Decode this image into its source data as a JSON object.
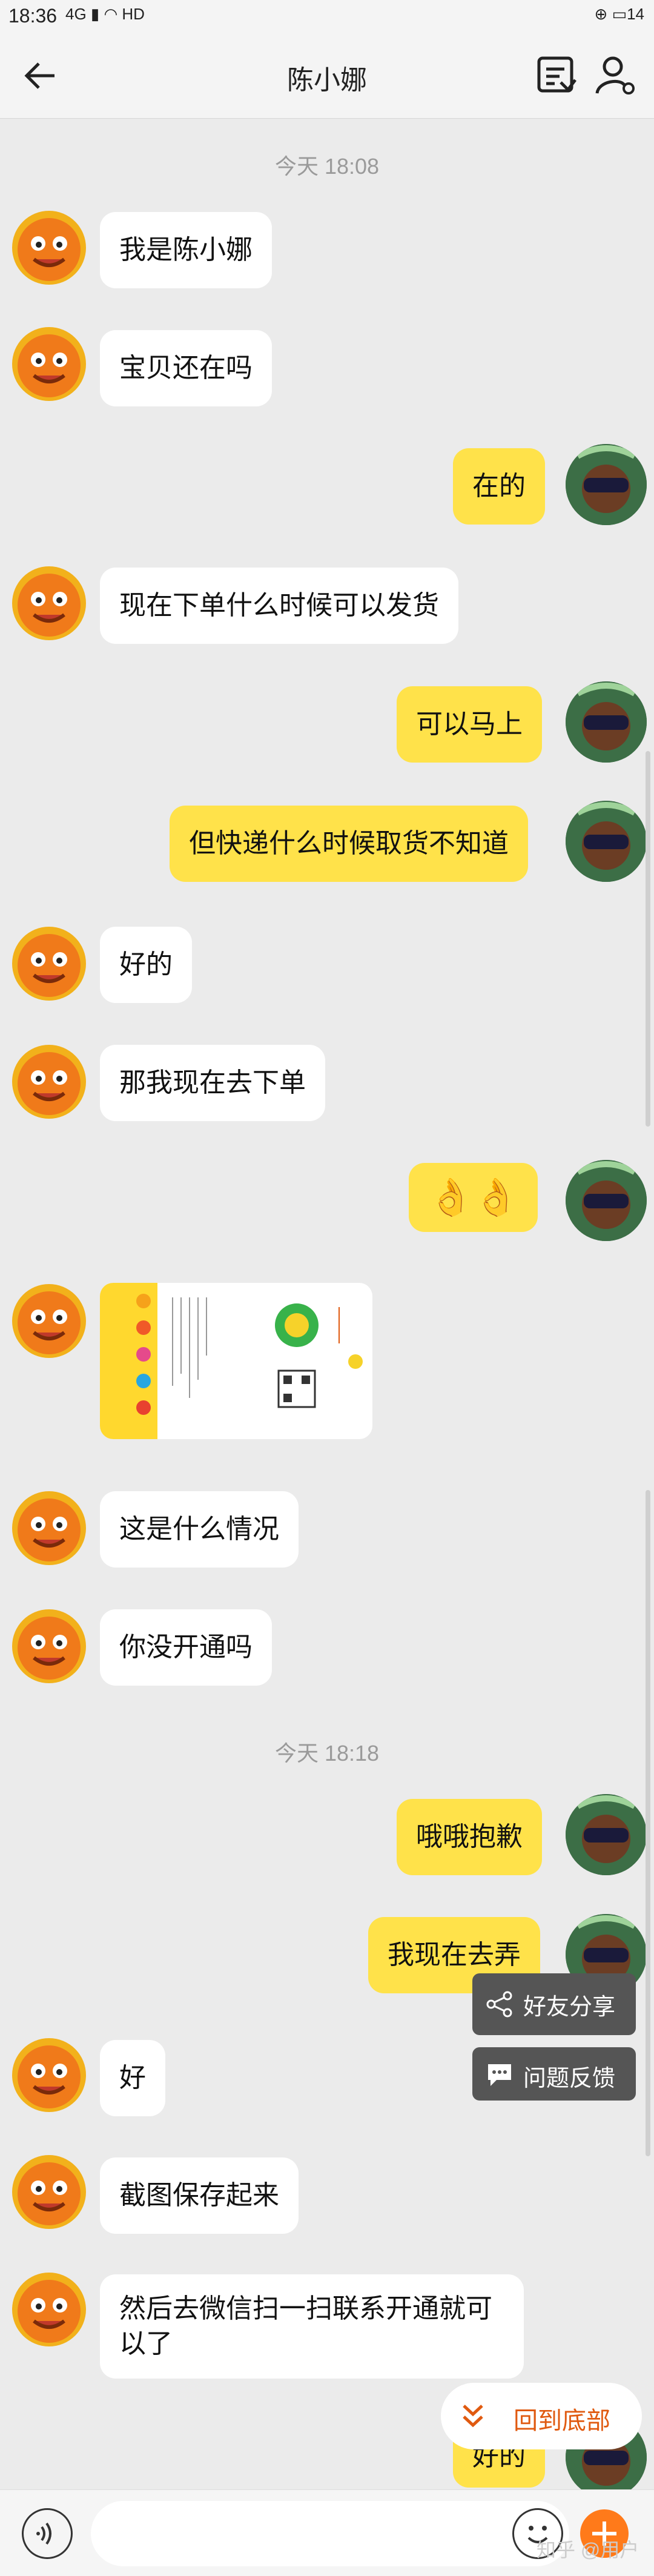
{
  "status_bar": {
    "time": "18:36",
    "network": "4G",
    "hd": "HD",
    "battery": "14"
  },
  "header": {
    "back_icon": "back-arrow-icon",
    "title": "陈小娜",
    "order_icon": "order-form-icon",
    "profile_icon": "user-settings-icon"
  },
  "chat": {
    "timestamps": [
      "今天  18:08",
      "今天  18:18"
    ],
    "messages": [
      {
        "side": "left",
        "text": "我是陈小娜"
      },
      {
        "side": "left",
        "text": "宝贝还在吗"
      },
      {
        "side": "right",
        "text": "在的"
      },
      {
        "side": "left",
        "text": "现在下单什么时候可以发货"
      },
      {
        "side": "right",
        "text": "可以马上"
      },
      {
        "side": "right",
        "text": "但快递什么时候取货不知道"
      },
      {
        "side": "left",
        "text": "好的"
      },
      {
        "side": "left",
        "text": "那我现在去下单"
      },
      {
        "side": "right",
        "text": "👌👌"
      },
      {
        "side": "left",
        "text": "[图片]"
      },
      {
        "side": "left",
        "text": "这是什么情况"
      },
      {
        "side": "left",
        "text": "你没开通吗"
      },
      {
        "side": "right",
        "text": "哦哦抱歉"
      },
      {
        "side": "right",
        "text": "我现在去弄"
      },
      {
        "side": "left",
        "text": "好"
      },
      {
        "side": "left",
        "text": "截图保存起来"
      },
      {
        "side": "left",
        "text": "然后去微信扫一扫联系开通就可以了"
      },
      {
        "side": "right",
        "text": "好的"
      }
    ]
  },
  "floating": {
    "share_label": "好友分享",
    "feedback_label": "问题反馈",
    "back_to_bottom_label": "回到底部"
  },
  "input": {
    "value": "",
    "placeholder": ""
  },
  "watermark": "知乎 @用户"
}
